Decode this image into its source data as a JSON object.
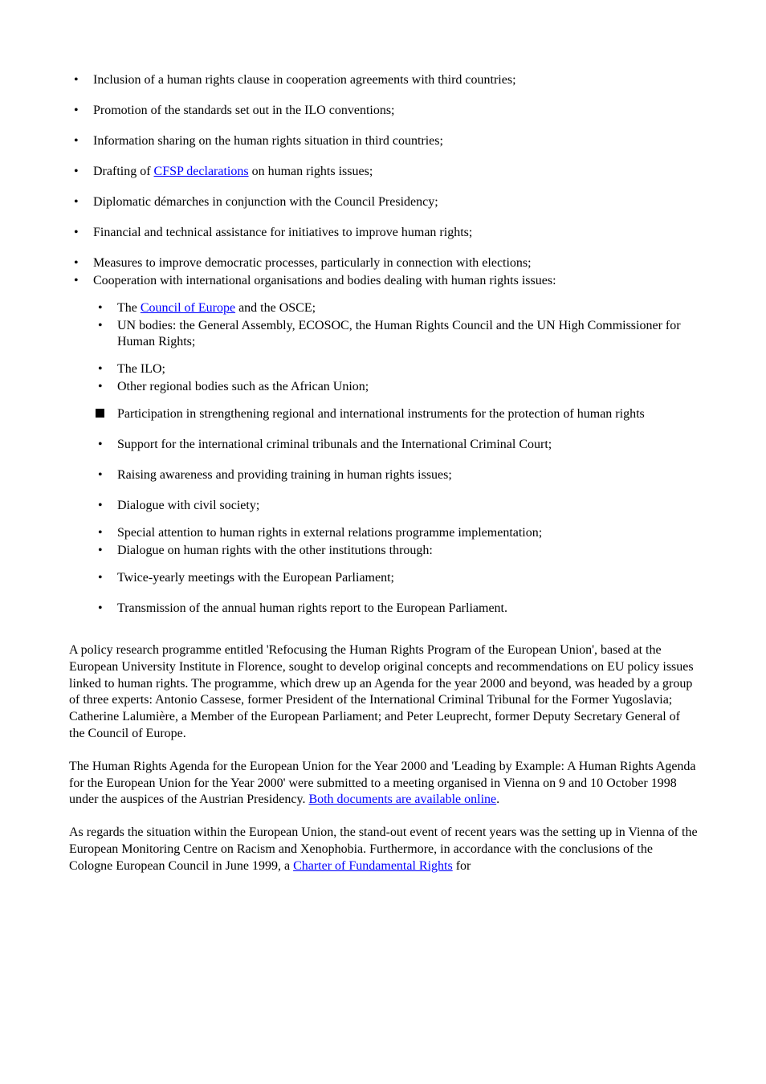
{
  "bullets": {
    "b1": "Inclusion of a human rights clause in cooperation agreements with third countries;",
    "b2": "Promotion of the standards set out in the ILO conventions;",
    "b3": "Information sharing on the human rights situation in third countries;",
    "b4": {
      "pre": "Drafting of ",
      "link": "CFSP declarations",
      "post": " on human rights issues;"
    },
    "b5": "Diplomatic démarches in conjunction with the Council Presidency;",
    "b6": "Financial and technical assistance for initiatives to improve human rights;",
    "b7_1": "Measures to improve democratic processes, particularly in connection with elections;",
    "b7_2": "Cooperation with international organisations and bodies dealing with human rights issues:",
    "sub_a_pre": "The ",
    "sub_a_link": "Council of Europe",
    "sub_a_post": " and the OSCE;",
    "sub_b": "UN bodies: the General Assembly, ECOSOC, the Human Rights Council and the UN High Commissioner for Human Rights;",
    "sub_c": "The ILO;",
    "sub_d": "Other regional bodies such as the African Union;",
    "sub_e": "Participation in strengthening regional and international instruments for the protection of human rights",
    "b8": "Support for the international criminal tribunals and the International Criminal Court;",
    "b9": "Raising awareness and providing training in human rights issues;",
    "b10": "Dialogue with civil society;",
    "b11": "Special attention to human rights in external relations programme implementation;",
    "b12": "Dialogue on human rights with the other institutions through:",
    "b13": "Twice-yearly meetings with the European Parliament;",
    "b14": "Transmission of the annual human rights report to the European Parliament."
  },
  "paragraphs": {
    "p1": "A policy research programme entitled 'Refocusing the Human Rights Program of the European Union', based at the European University Institute in Florence, sought to develop original concepts and recommendations on EU policy issues linked to human rights. The programme, which drew up an Agenda for the year 2000 and beyond, was headed by a group of three experts: Antonio Cassese, former President of the International Criminal Tribunal for the Former Yugoslavia; Catherine Lalumière, a Member of the European Parliament; and Peter Leuprecht, former Deputy Secretary General of the Council of Europe.",
    "p2_pre": "The Human Rights Agenda for the European Union for the Year 2000 and 'Leading by Example: A Human Rights Agenda for the European Union for the Year 2000' were submitted to a meeting organised in Vienna on 9 and 10 October 1998 under the auspices of the Austrian Presidency. ",
    "p2_link": "Both documents are available online",
    "p2_post": ".",
    "p3_pre": "As regards the situation within the European Union, the stand-out event of recent years was the setting up in Vienna of the European Monitoring Centre on Racism and Xenophobia. Furthermore, in accordance with the conclusions of the Cologne European Council in June 1999, a ",
    "p3_link": "Charter of Fundamental Rights",
    "p3_post": " for"
  }
}
